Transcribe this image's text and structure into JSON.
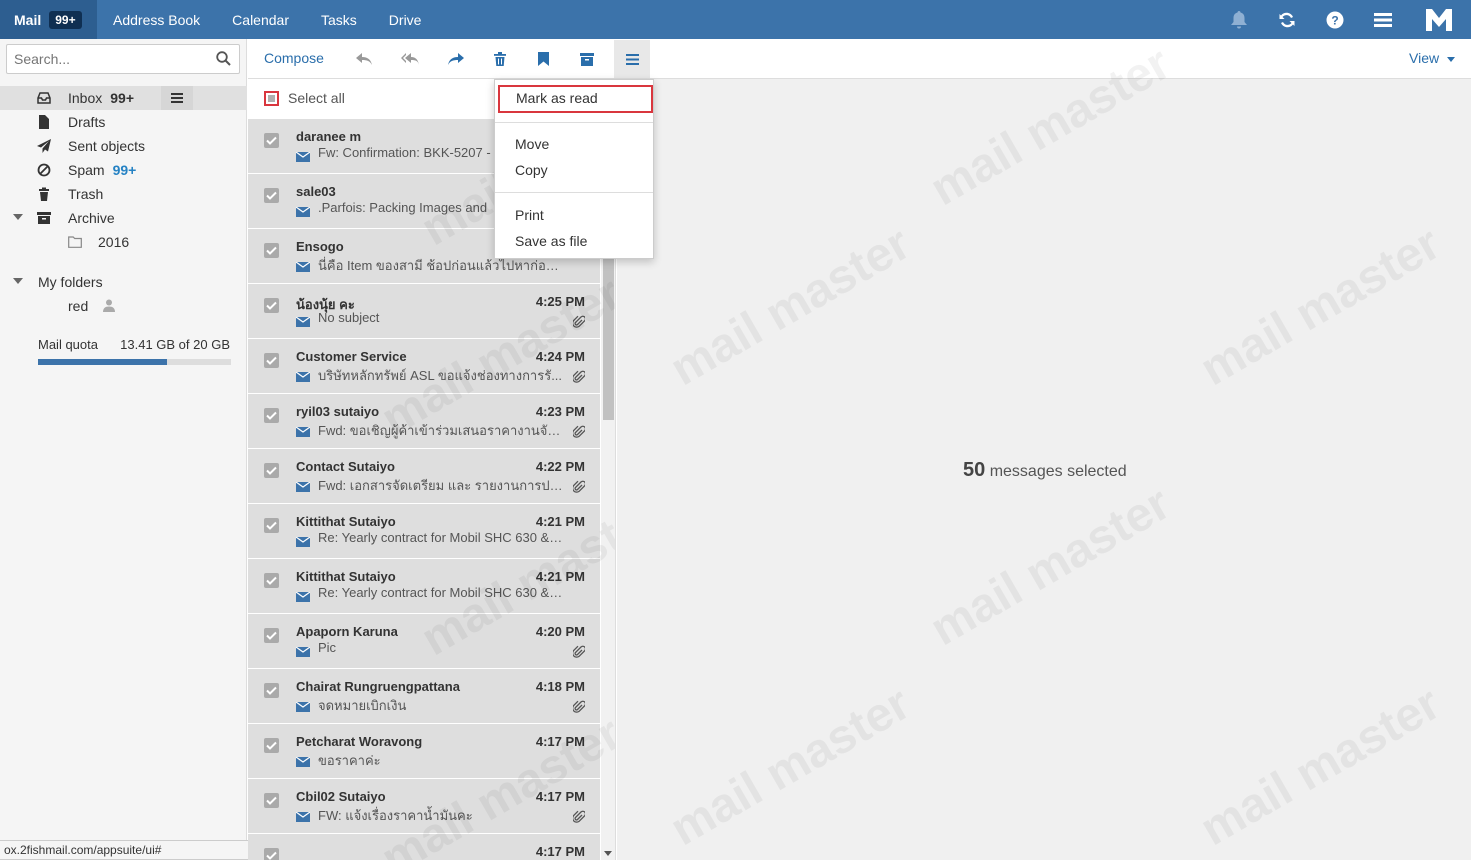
{
  "topnav": {
    "items": [
      {
        "label": "Mail",
        "badge": "99+"
      },
      {
        "label": "Address Book"
      },
      {
        "label": "Calendar"
      },
      {
        "label": "Tasks"
      },
      {
        "label": "Drive"
      }
    ]
  },
  "search": {
    "placeholder": "Search..."
  },
  "folders": {
    "inbox": {
      "label": "Inbox",
      "count": "99+"
    },
    "drafts": {
      "label": "Drafts"
    },
    "sent": {
      "label": "Sent objects"
    },
    "spam": {
      "label": "Spam",
      "count": "99+"
    },
    "trash": {
      "label": "Trash"
    },
    "archive": {
      "label": "Archive"
    },
    "archive_2016": {
      "label": "2016"
    },
    "my_folders": {
      "label": "My folders"
    },
    "red": {
      "label": "red"
    }
  },
  "quota": {
    "label": "Mail quota",
    "value": "13.41 GB of 20 GB",
    "fraction": 0.67
  },
  "status_url": "ox.2fishmail.com/appsuite/ui#",
  "toolbar": {
    "compose": "Compose",
    "view": "View"
  },
  "list": {
    "select_all": "Select all"
  },
  "messages": [
    {
      "from": "daranee m",
      "time": "",
      "subject": "Fw: Confirmation: BKK-5207 -",
      "attachment": false
    },
    {
      "from": "sale03",
      "time": "",
      "subject": ".Parfois: Packing Images and",
      "attachment": false
    },
    {
      "from": "Ensogo",
      "time": "",
      "subject": "นี่คือ Item ของสามี ช้อปก่อนแล้วไปหาก่อนย์ ร...",
      "attachment": false
    },
    {
      "from": "น้องนุ้ย คะ",
      "time": "4:25 PM",
      "subject": "No subject",
      "attachment": true
    },
    {
      "from": "Customer Service",
      "time": "4:24 PM",
      "subject": "บริษัทหลักทรัพย์ ASL ขอแจ้งช่องทางการรั...",
      "attachment": true
    },
    {
      "from": "ryil03 sutaiyo",
      "time": "4:23 PM",
      "subject": "Fwd: ขอเชิญผู้ค้าเข้าร่วมเสนอราคางานจัดหา...",
      "attachment": true
    },
    {
      "from": "Contact Sutaiyo",
      "time": "4:22 PM",
      "subject": "Fwd: เอกสารจัดเตรียม และ รายงานการประ...",
      "attachment": true
    },
    {
      "from": "Kittithat Sutaiyo",
      "time": "4:21 PM",
      "subject": "Re: Yearly contract for Mobil SHC 630 & MO...",
      "attachment": false
    },
    {
      "from": "Kittithat Sutaiyo",
      "time": "4:21 PM",
      "subject": "Re: Yearly contract for Mobil SHC 630 & MO...",
      "attachment": false
    },
    {
      "from": "Apaporn Karuna",
      "time": "4:20 PM",
      "subject": "Pic",
      "attachment": true
    },
    {
      "from": "Chairat Rungruengpattana",
      "time": "4:18 PM",
      "subject": "จดหมายเบิกเงิน",
      "attachment": true
    },
    {
      "from": "Petcharat Woravong",
      "time": "4:17 PM",
      "subject": "ขอราคาค่ะ",
      "attachment": false
    },
    {
      "from": "Cbil02 Sutaiyo",
      "time": "4:17 PM",
      "subject": "FW: แจ้งเรื่องราคาน้ำมันคะ",
      "attachment": true
    },
    {
      "from": "",
      "time": "4:17 PM",
      "subject": "",
      "attachment": false
    }
  ],
  "detail": {
    "count": "50",
    "text": "messages selected"
  },
  "dropdown": {
    "mark_read": "Mark as read",
    "move": "Move",
    "copy": "Copy",
    "print": "Print",
    "save_file": "Save as file"
  },
  "colors": {
    "brand": "#3c73aa",
    "highlight_border": "#d9363e",
    "link": "#2a6eab"
  }
}
